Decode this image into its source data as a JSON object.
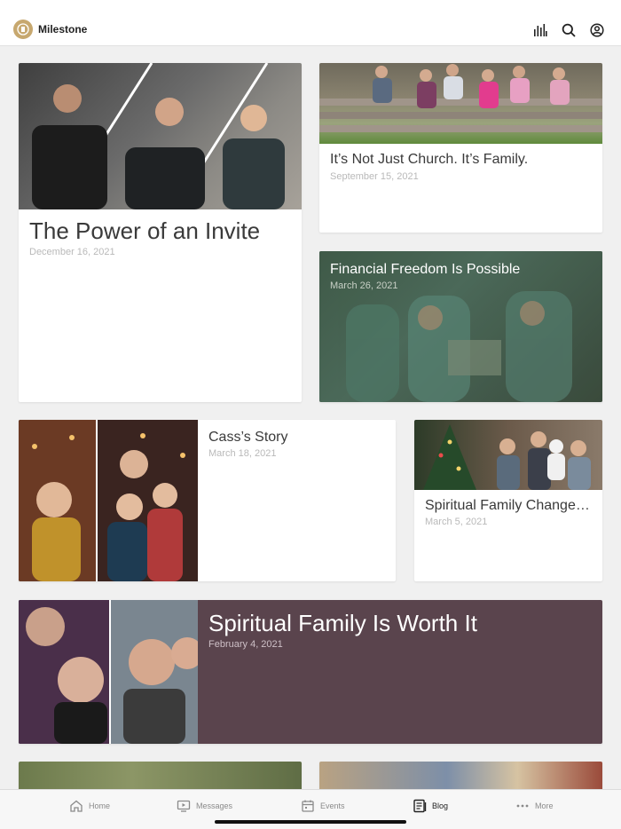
{
  "app": {
    "name": "Milestone"
  },
  "header_icons": [
    "equalizer-icon",
    "search-icon",
    "account-icon"
  ],
  "posts": [
    {
      "title": "The Power of an Invite",
      "date": "December 16, 2021"
    },
    {
      "title": "It’s Not Just Church. It’s Family.",
      "date": "September 15, 2021"
    },
    {
      "title": "Financial Freedom Is Possible",
      "date": "March 26, 2021"
    },
    {
      "title": "Cass’s Story",
      "date": "March 18, 2021"
    },
    {
      "title": "Spiritual Family Changes…",
      "date": "March 5, 2021"
    },
    {
      "title": "Spiritual Family Is Worth It",
      "date": "February 4, 2021"
    }
  ],
  "tabs": [
    {
      "label": "Home",
      "icon": "home-icon"
    },
    {
      "label": "Messages",
      "icon": "messages-icon"
    },
    {
      "label": "Events",
      "icon": "calendar-icon"
    },
    {
      "label": "Blog",
      "icon": "blog-icon",
      "active": true
    },
    {
      "label": "More",
      "icon": "more-icon"
    }
  ],
  "colors": {
    "featured_purple": "#5a444d",
    "financial_green": "#3b4a3a",
    "logo_gold": "#c7a86f"
  }
}
